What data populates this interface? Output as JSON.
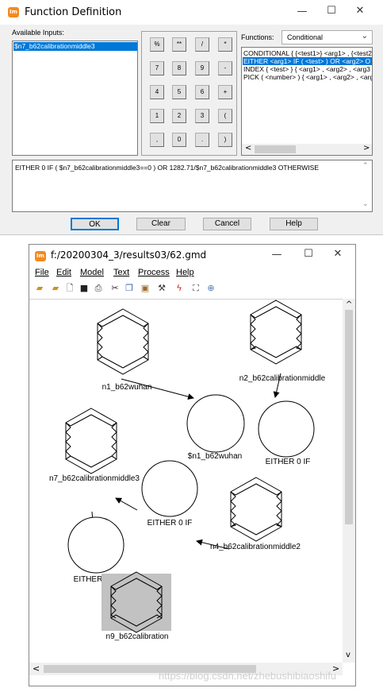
{
  "dialog": {
    "title": "Function Definition",
    "available_inputs_label": "Available Inputs:",
    "inputs": [
      "$n7_b62calibrationmiddle3"
    ],
    "keypad": [
      "%",
      "**",
      "/",
      "*",
      "7",
      "8",
      "9",
      "-",
      "4",
      "5",
      "6",
      "+",
      "1",
      "2",
      "3",
      "(",
      ",",
      "0",
      ".",
      ")"
    ],
    "functions_label": "Functions:",
    "functions_category": "Conditional",
    "functions": [
      "CONDITIONAL { {<test1>} <arg1> , {<test2",
      "EITHER <arg1> IF ( <test> ) OR <arg2> O",
      "INDEX { <test> } { <arg1> , <arg2> , <arg3",
      "PICK ( <number> ) { <arg1> , <arg2> , <arg"
    ],
    "expression": "EITHER 0 IF ( $n7_b62calibrationmiddle3==0 ) OR 1282.71/$n7_b62calibrationmiddle3 OTHERWISE",
    "buttons": {
      "ok": "OK",
      "clear": "Clear",
      "cancel": "Cancel",
      "help": "Help"
    },
    "controls": {
      "minimize": "—",
      "maximize": "☐",
      "close": "✕"
    }
  },
  "model_window": {
    "title": "f:/20200304_3/results03/62.gmd",
    "menu": [
      "File",
      "Edit",
      "Model",
      "Text",
      "Process",
      "Help"
    ],
    "toolbar_icons": [
      "open-folder-icon",
      "new-folder-icon",
      "new-page-icon",
      "save-icon",
      "print-icon",
      "cut-icon",
      "copy-icon",
      "paste-icon",
      "hammer-icon",
      "run-icon",
      "fit-icon",
      "zoom-icon"
    ],
    "controls": {
      "minimize": "—",
      "maximize": "☐",
      "close": "✕"
    },
    "scroll": {
      "up": "^",
      "down": "v",
      "left": "<",
      "right": ">"
    },
    "nodes": {
      "n1": "n1_b62wuhan",
      "n2": "n2_b62calibrationmiddle",
      "d1": "$n1_b62wuhan",
      "e1": "EITHER 0 IF",
      "n7": "n7_b62calibrationmiddle3",
      "e2": "EITHER 0 IF",
      "n4": "n4_b62calibrationmiddle2",
      "e3": "EITHER 0 IF",
      "n9": "n9_b62calibration"
    }
  },
  "watermark": "https://blog.csdn.net/zhebushibiaoshifu",
  "accent": "#0078d7"
}
